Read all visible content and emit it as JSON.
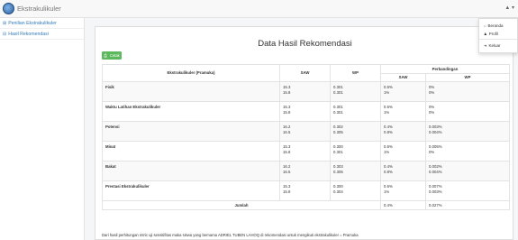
{
  "app": {
    "title": "Ekstrakulikuler",
    "user_caret": "▲ ▾"
  },
  "sidebar": {
    "items": [
      {
        "icon": "⊞",
        "label": "Penilian Ekstrakulikuler"
      },
      {
        "icon": "⊟",
        "label": "Hasil Rekomendasi"
      }
    ]
  },
  "user_menu": {
    "items": [
      {
        "icon": "⌂",
        "label": "Beranda"
      },
      {
        "icon": "♟",
        "label": "Profil"
      },
      {
        "icon": "➜",
        "label": "Keluar"
      }
    ]
  },
  "main": {
    "title": "Data Hasil Rekomendasi",
    "print_button": {
      "icon": "⎙",
      "label": "Cetak"
    },
    "table": {
      "headers": {
        "criteria": "Ekstrakulikuler (Pramuka)",
        "saw": "SAW",
        "wp": "WP",
        "comparison": "Perbandingan",
        "comp_saw": "SAW",
        "comp_wp": "WP"
      },
      "rows": [
        {
          "criteria": "Fisik",
          "saw": [
            "15.3",
            "15.8"
          ],
          "wp": [
            "0.301",
            "0.301"
          ],
          "comp_saw": [
            "0.5%",
            "1%"
          ],
          "comp_wp": [
            "0%",
            "0%"
          ]
        },
        {
          "criteria": "Waktu Latihan Ekstrakulikuler",
          "saw": [
            "15.3",
            "15.8"
          ],
          "wp": [
            "0.301",
            "0.301"
          ],
          "comp_saw": [
            "0.5%",
            "1%"
          ],
          "comp_wp": [
            "0%",
            "0%"
          ]
        },
        {
          "criteria": "Potensi",
          "saw": [
            "16.2",
            "16.5"
          ],
          "wp": [
            "0.302",
            "0.305"
          ],
          "comp_saw": [
            "0.4%",
            "0.8%"
          ],
          "comp_wp": [
            "0.003%",
            "0.004%"
          ]
        },
        {
          "criteria": "Minat",
          "saw": [
            "15.3",
            "15.8"
          ],
          "wp": [
            "0.300",
            "0.301"
          ],
          "comp_saw": [
            "0.5%",
            "1%"
          ],
          "comp_wp": [
            "0.005%",
            "0%"
          ]
        },
        {
          "criteria": "Bakat",
          "saw": [
            "16.2",
            "16.5"
          ],
          "wp": [
            "0.303",
            "0.305"
          ],
          "comp_saw": [
            "0.4%",
            "0.8%"
          ],
          "comp_wp": [
            "0.002%",
            "0.004%"
          ]
        },
        {
          "criteria": "Prestasi Ekstrakulikuler",
          "saw": [
            "15.3",
            "15.8"
          ],
          "wp": [
            "0.300",
            "0.304"
          ],
          "comp_saw": [
            "0.5%",
            "1%"
          ],
          "comp_wp": [
            "0.007%",
            "0.003%"
          ]
        }
      ],
      "footer": {
        "label": "Jumlah",
        "comp_saw": "0.4%",
        "comp_wp": "0.027%"
      }
    },
    "note": "Dari hasil perhitungan mtric uji sensitifitas maka siswa yang bernama ADRIEL TUBEN LAHOQ di rekomendasi untuk mengikuti ekstrakulikuler = Pramuka"
  }
}
